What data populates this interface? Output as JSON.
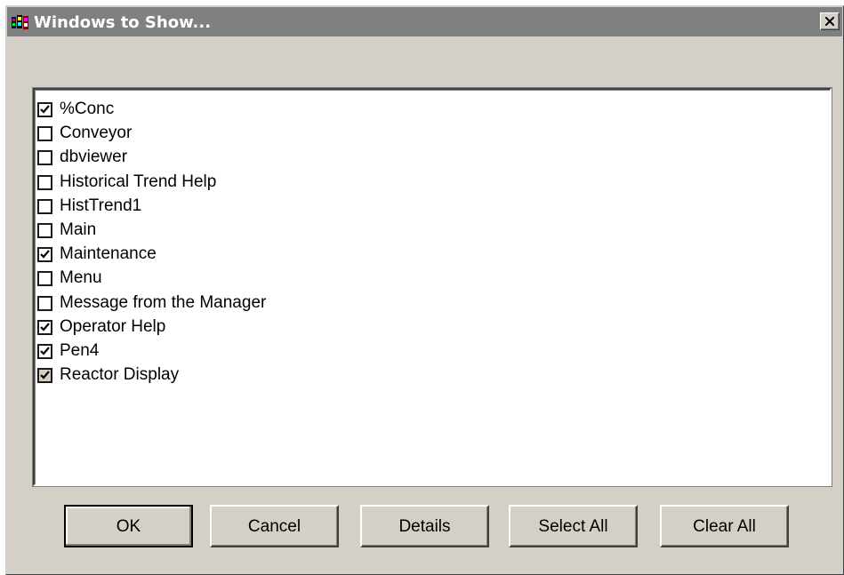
{
  "window": {
    "title": "Windows to Show...",
    "icon": "multi-window-app-icon"
  },
  "items": [
    {
      "label": "%Conc",
      "checked": true
    },
    {
      "label": "Conveyor",
      "checked": false
    },
    {
      "label": "dbviewer",
      "checked": false
    },
    {
      "label": "Historical Trend Help",
      "checked": false
    },
    {
      "label": "HistTrend1",
      "checked": false
    },
    {
      "label": "Main",
      "checked": false
    },
    {
      "label": "Maintenance",
      "checked": true
    },
    {
      "label": "Menu",
      "checked": false
    },
    {
      "label": "Message from the Manager",
      "checked": false
    },
    {
      "label": "Operator Help",
      "checked": true
    },
    {
      "label": "Pen4",
      "checked": true
    },
    {
      "label": "Reactor Display",
      "checked": true,
      "greyed": true
    }
  ],
  "buttons": {
    "ok": "OK",
    "cancel": "Cancel",
    "details": "Details",
    "select_all": "Select All",
    "clear_all": "Clear All"
  },
  "colors": {
    "dialog_face": "#d4d0c8",
    "titlebar": "#808080",
    "title_text": "#ffffff"
  }
}
